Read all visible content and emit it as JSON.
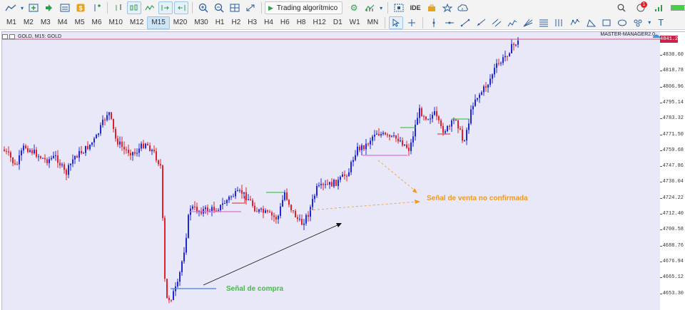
{
  "toolbar": {
    "algo_label": "Trading algorítmico",
    "ide_label": "IDE",
    "notif_count": "1",
    "timeframes": [
      "M1",
      "M2",
      "M3",
      "M4",
      "M5",
      "M6",
      "M10",
      "M12",
      "M15",
      "M20",
      "M30",
      "H1",
      "H2",
      "H3",
      "H4",
      "H6",
      "H8",
      "H12",
      "D1",
      "W1",
      "MN"
    ],
    "active_timeframe": "M15"
  },
  "chart": {
    "symbol_header": "GOLD, M15:  GOLD",
    "expert_name": "MASTER-MANAGER2.0",
    "current_price": "4841.20",
    "price_axis": [
      "4830.60",
      "4818.78",
      "4806.96",
      "4795.14",
      "4783.32",
      "4771.50",
      "4759.68",
      "4747.86",
      "4736.04",
      "4724.22",
      "4712.40",
      "4700.58",
      "4688.76",
      "4676.94",
      "4665.12",
      "4653.30"
    ],
    "annotation_buy": "Señal de compra",
    "annotation_sell": "Señal de venta no confirmada",
    "colors": {
      "bull": "#1f27d6",
      "bear": "#e0202a",
      "buy_line": "#4a7fd4",
      "sell_line": "#e070d8",
      "green_line": "#22bb22",
      "red_line": "#dd2222",
      "buy_text": "#3ec23e",
      "sell_text": "#f09a1e"
    }
  }
}
